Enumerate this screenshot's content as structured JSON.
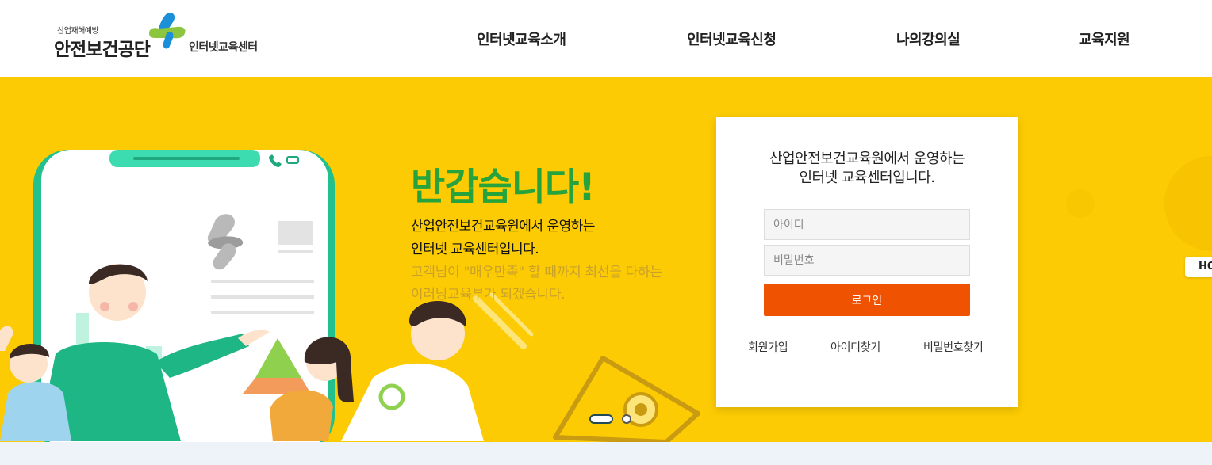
{
  "header": {
    "logo_subtitle": "산업재해예방",
    "logo_title": "안전보건공단",
    "logo_center": "인터넷교육센터",
    "nav": [
      {
        "label": "인터넷교육소개"
      },
      {
        "label": "인터넷교육신청"
      },
      {
        "label": "나의강의실"
      },
      {
        "label": "교육지원"
      }
    ]
  },
  "hero": {
    "welcome": "반갑습니다!",
    "intro_line1": "산업안전보건교육원에서 운영하는",
    "intro_line2": "인터넷 교육센터입니다.",
    "intro_line3": "고객님이 \"매우만족\" 할 때까지 최선을 다하는",
    "intro_line4": "이러닝교육부가 되겠습니다."
  },
  "login": {
    "title_line1": "산업안전보건교육원에서 운영하는",
    "title_line2": "인터넷 교육센터입니다.",
    "id_placeholder": "아이디",
    "pw_placeholder": "비밀번호",
    "login_button": "로그인",
    "links": {
      "signup": "회원가입",
      "find_id": "아이디찾기",
      "find_pw": "비밀번호찾기"
    }
  },
  "side_tab": "HO",
  "colors": {
    "hero_bg": "#fccb03",
    "welcome_green": "#26a33c",
    "login_button": "#ef5200",
    "logo_blue": "#1b8fd8",
    "logo_green": "#8cc63f"
  },
  "icons": [
    "logo-cross-icon",
    "phone-icon",
    "battery-icon"
  ]
}
